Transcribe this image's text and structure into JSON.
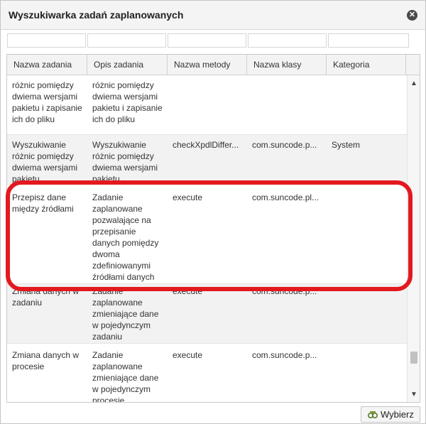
{
  "dialog": {
    "title": "Wyszukiwarka zadań zaplanowanych",
    "close_icon": "close-icon"
  },
  "filters": [
    "",
    "",
    "",
    "",
    ""
  ],
  "columns": [
    "Nazwa zadania",
    "Opis zadania",
    "Nazwa metody",
    "Nazwa klasy",
    "Kategoria"
  ],
  "rows": [
    [
      "różnic pomiędzy dwiema wersjami pakietu i zapisanie ich do pliku",
      "różnic pomiędzy dwiema wersjami pakietu i zapisanie ich do pliku",
      "",
      "",
      ""
    ],
    [
      "Wyszukiwanie różnic pomiędzy dwiema wersjami pakietu",
      "Wyszukiwanie różnic pomiędzy dwiema wersjami pakietu",
      "checkXpdlDiffer...",
      "com.suncode.p...",
      "System"
    ],
    [
      "Przepisz dane między źródłami",
      "Zadanie zaplanowane pozwalające na przepisanie danych pomiędzy dwoma zdefiniowanymi źródłami danych",
      "execute",
      "com.suncode.pl...",
      ""
    ],
    [
      "Zmiana danych w zadaniu",
      "Zadanie zaplanowane zmieniające dane w pojedynczym zadaniu",
      "execute",
      "com.suncode.p...",
      ""
    ],
    [
      "Zmiana danych w procesie",
      "Zadanie zaplanowane zmieniające dane w pojedynczym procesie",
      "execute",
      "com.suncode.p...",
      ""
    ]
  ],
  "footer": {
    "select_label": "Wybierz",
    "select_icon": "select-icon"
  },
  "colors": {
    "highlight": "#e3191f",
    "alt_row": "#f2f2f2"
  }
}
